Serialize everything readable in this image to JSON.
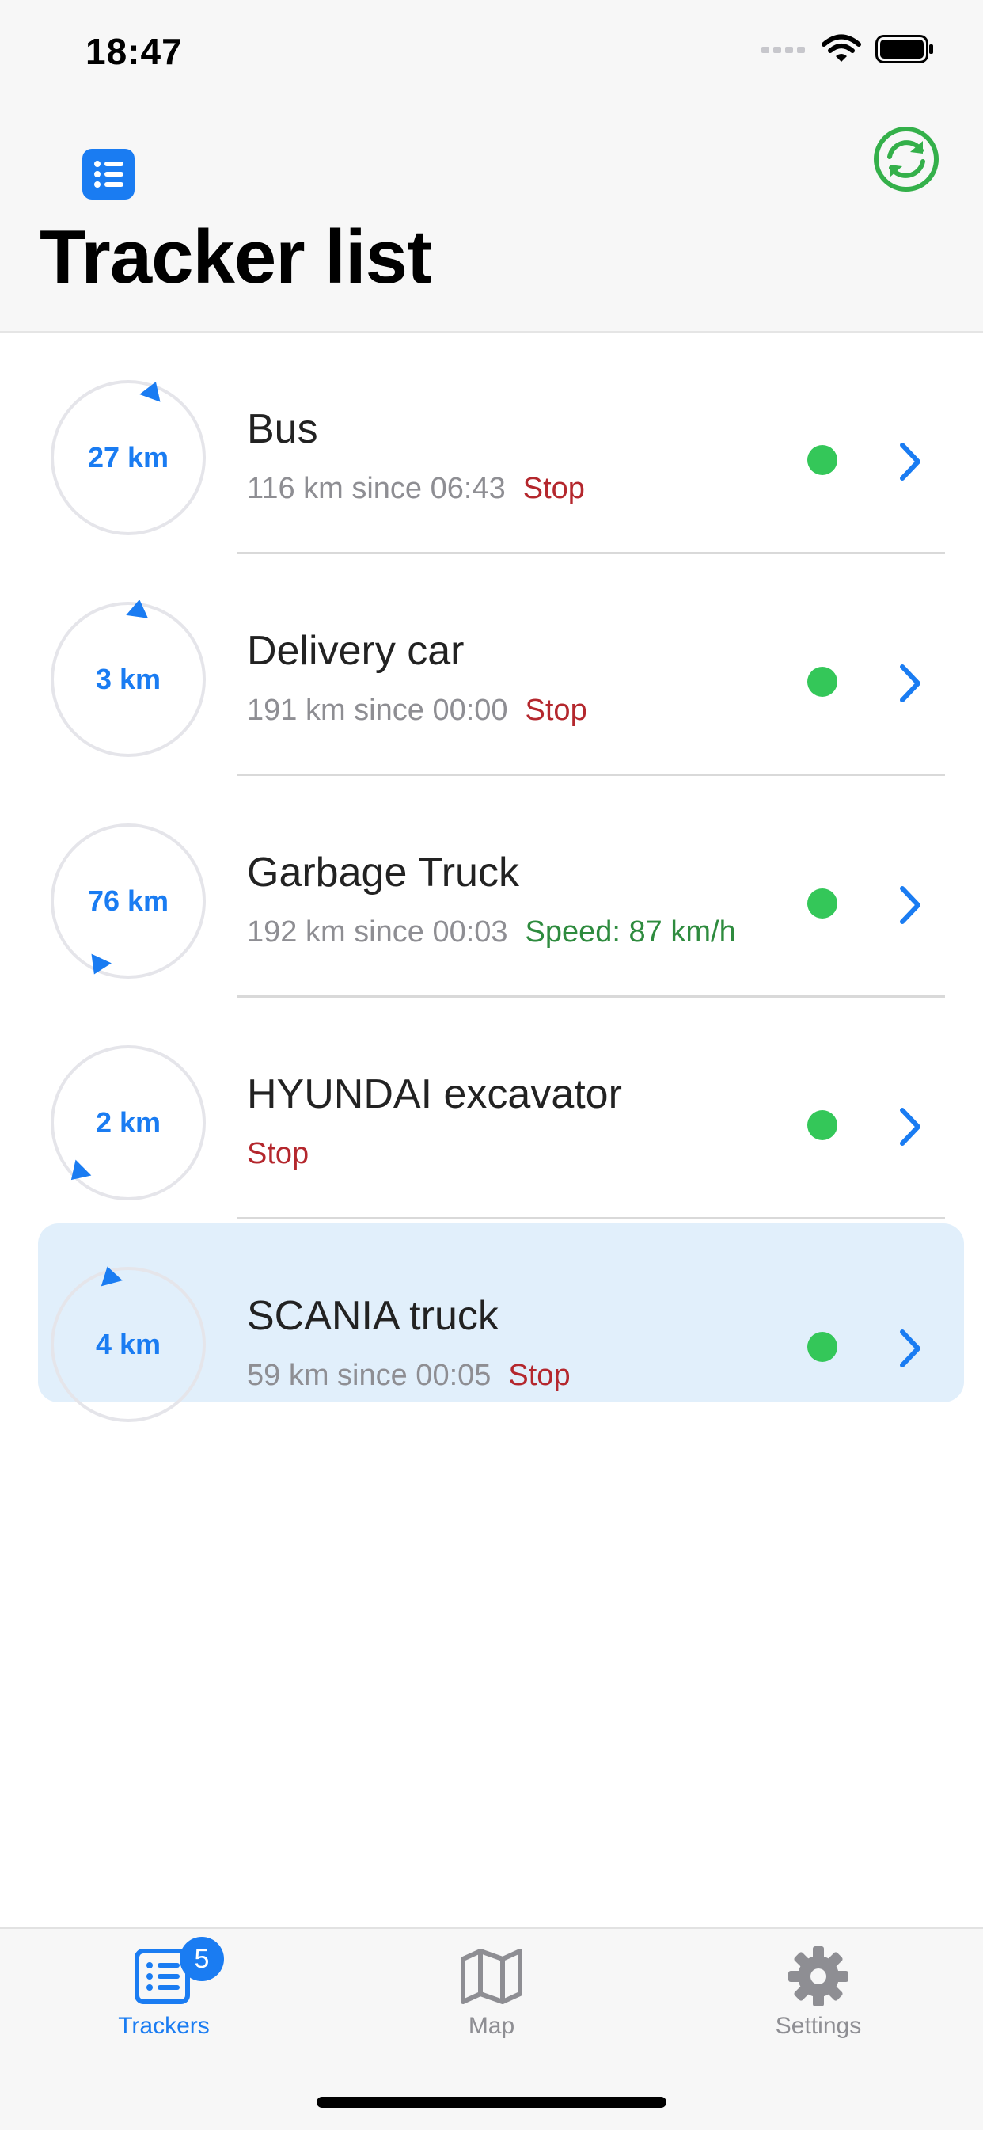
{
  "status_bar": {
    "time": "18:47",
    "icons": [
      "cellular-signal-icon",
      "wifi-icon",
      "battery-icon"
    ]
  },
  "header": {
    "title": "Tracker list",
    "left_icon": "list-icon",
    "right_icon": "refresh-icon"
  },
  "trackers": [
    {
      "distance": "27 km",
      "name": "Bus",
      "summary": "116 km since 06:43",
      "state": "Stop",
      "state_type": "stop",
      "online": true,
      "heading_deg": 20,
      "selected": false
    },
    {
      "distance": "3 km",
      "name": "Delivery car",
      "summary": "191 km since 00:00",
      "state": "Stop",
      "state_type": "stop",
      "online": true,
      "heading_deg": 8,
      "selected": false
    },
    {
      "distance": "76 km",
      "name": "Garbage Truck",
      "summary": "192 km since 00:03",
      "state": "Speed: 87 km/h",
      "state_type": "moving",
      "online": true,
      "heading_deg": 205,
      "selected": false
    },
    {
      "distance": "2 km",
      "name": "HYUNDAI excavator",
      "summary": "",
      "state": "Stop",
      "state_type": "stop",
      "online": true,
      "heading_deg": 225,
      "selected": false
    },
    {
      "distance": "4 km",
      "name": "SCANIA truck",
      "summary": "59 km since 00:05",
      "state": "Stop",
      "state_type": "stop",
      "online": true,
      "heading_deg": -15,
      "selected": true
    }
  ],
  "tabbar": {
    "tabs": [
      {
        "label": "Trackers",
        "icon": "trackers-icon",
        "active": true,
        "badge": "5"
      },
      {
        "label": "Map",
        "icon": "map-icon",
        "active": false
      },
      {
        "label": "Settings",
        "icon": "gear-icon",
        "active": false
      }
    ]
  },
  "colors": {
    "accent": "#1a7cf2",
    "online": "#34c759",
    "stop": "#b4272d",
    "moving": "#2e8b3e",
    "refresh": "#34b04a"
  }
}
